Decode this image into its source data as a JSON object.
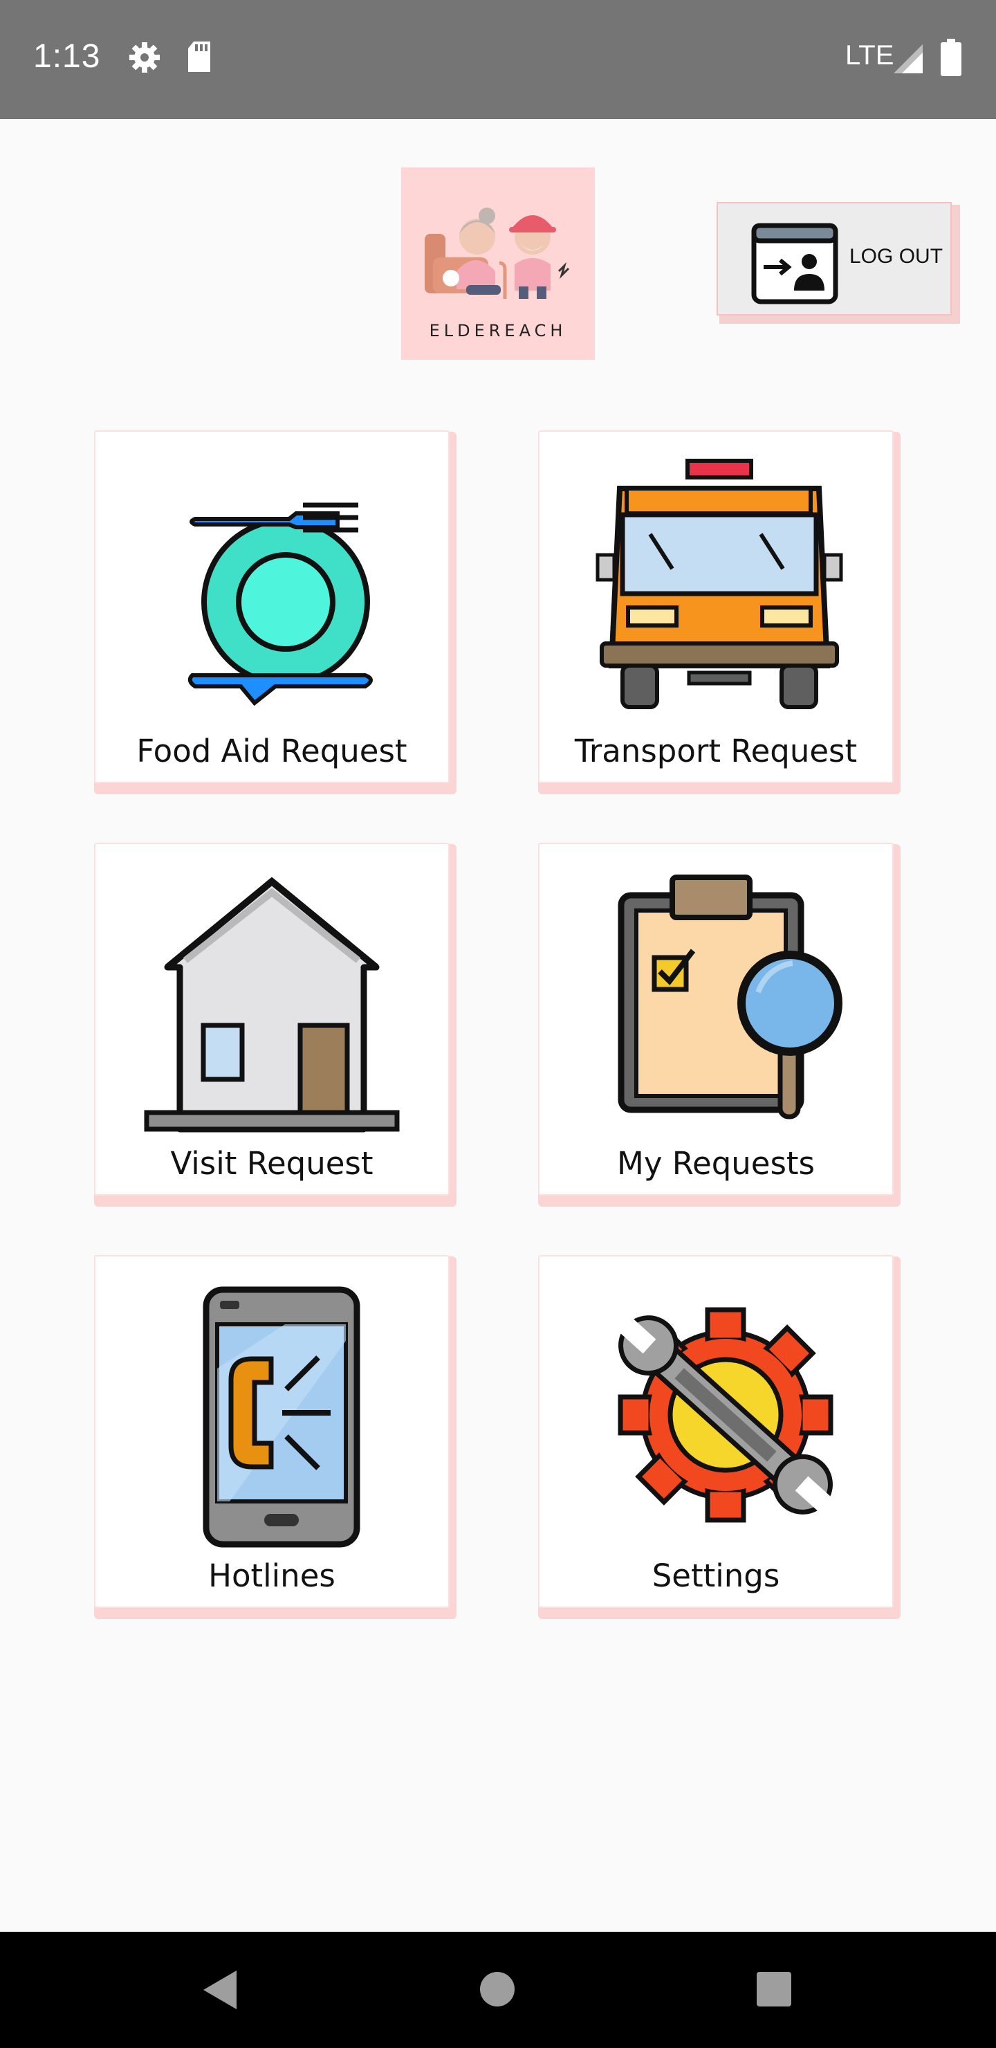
{
  "status_bar": {
    "time": "1:13",
    "network": "LTE",
    "icons": [
      "gear-icon",
      "sd-card-icon",
      "signal-icon",
      "battery-icon"
    ]
  },
  "app": {
    "logo_text": "ELDEREACH",
    "logout_label": "LOG OUT"
  },
  "menu": {
    "items": [
      {
        "label": "Food Aid Request",
        "icon": "plate-fork-icon"
      },
      {
        "label": "Transport Request",
        "icon": "bus-icon"
      },
      {
        "label": "Visit Request",
        "icon": "house-icon"
      },
      {
        "label": "My Requests",
        "icon": "clipboard-search-icon"
      },
      {
        "label": "Hotlines",
        "icon": "phone-icon"
      },
      {
        "label": "Settings",
        "icon": "gear-wrench-icon"
      }
    ]
  },
  "nav_bar": {
    "icons": [
      "back-icon",
      "home-icon",
      "recents-icon"
    ]
  },
  "colors": {
    "status_bar": "#757575",
    "card_shadow": "#fbd4d4",
    "logo_bg": "#ffd6d6"
  }
}
